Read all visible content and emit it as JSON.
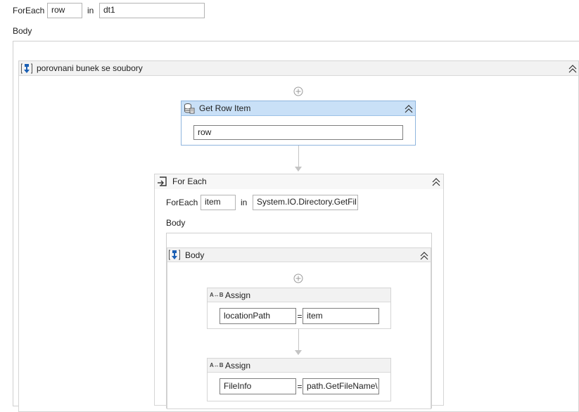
{
  "outer": {
    "foreach_label": "ForEach",
    "item_var": "row",
    "in_label": "in",
    "collection": "dt1",
    "body_label": "Body"
  },
  "sequence": {
    "title": "porovnani bunek se soubory"
  },
  "get_row_item": {
    "title": "Get Row Item",
    "row_value": "row"
  },
  "inner_foreach": {
    "title": "For Each",
    "foreach_label": "ForEach",
    "item_var": "item",
    "in_label": "in",
    "collection": "System.IO.Directory.GetFil",
    "body_label": "Body",
    "body_sequence_title": "Body"
  },
  "assign1": {
    "title": "Assign",
    "to": "locationPath",
    "eq": "=",
    "value": "item"
  },
  "assign2": {
    "title": "Assign",
    "to": "FileInfo",
    "eq": "=",
    "value": "path.GetFileName\\"
  },
  "icons": {
    "sequence": "sequence-icon",
    "database": "database-icon",
    "foreach": "foreach-icon",
    "assign": "assign-icon",
    "collapse": "collapse-chevron-icon",
    "add": "add-activity-icon"
  },
  "colors": {
    "selected_header": "#c9e0f7",
    "header": "#f2f2f2",
    "border": "#d5d5d5",
    "icon_blue": "#1a5fb4"
  }
}
